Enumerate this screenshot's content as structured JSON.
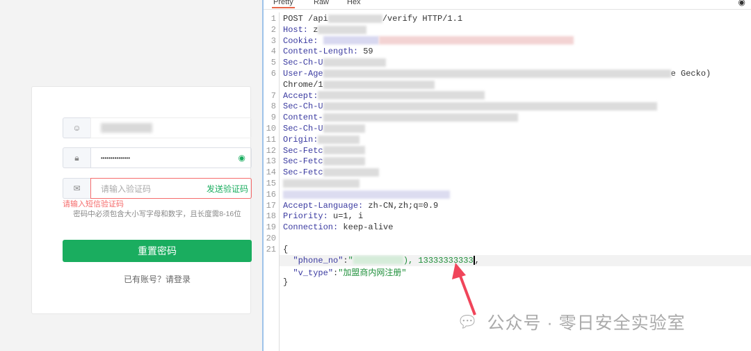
{
  "form": {
    "password_mask": "•••••••••••••••",
    "code_placeholder": "请输入验证码",
    "send_code": "发送验证码",
    "error": "请输入短信验证码",
    "hint": "密码中必须包含大小写字母和数字，且长度需8-16位",
    "reset_button": "重置密码",
    "login_link": "已有账号？请登录"
  },
  "tabs": [
    "Pretty",
    "Raw",
    "Hex"
  ],
  "request": {
    "l1a": "POST /api",
    "l1b": "/verify HTTP/1.1",
    "l2": "Host:",
    "l2v": " z",
    "l3": "Cookie:",
    "l4": "Content-Length:",
    "l4v": " 59",
    "l5": "Sec-Ch-U",
    "l6": "User-Age",
    "l6end": "e Gecko)",
    "l6c": "Chrome/1",
    "l7": "Accept:",
    "l8": "Sec-Ch-U",
    "l9": "Content-",
    "l10": "Sec-Ch-U",
    "l11": "Origin:",
    "l12": "Sec-Fetc",
    "l13": "Sec-Fetc",
    "l14": "Sec-Fetc",
    "l17": "Accept-Language:",
    "l17v": " zh-CN,zh;q=0.9",
    "l18": "Priority:",
    "l18v": " u=1, i",
    "l19": "Connection:",
    "l19v": " keep-alive",
    "b1": "{",
    "phone_key": "\"phone_no\"",
    "phone_val": "), 13333333333",
    "vtype_key": "\"v_type\"",
    "vtype_val": "\"加盟商内网注册\"",
    "b2": "}"
  },
  "watermark": "公众号 · 零日安全实验室"
}
